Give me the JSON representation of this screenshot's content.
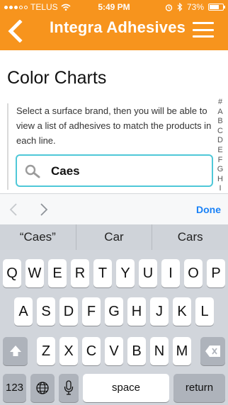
{
  "status_bar": {
    "carrier": "TELUS",
    "time": "5:49 PM",
    "battery": "73%",
    "battery_level": 0.73,
    "icons": [
      "signal-dots-icon",
      "wifi-icon",
      "alarm-icon",
      "bluetooth-icon",
      "battery-icon"
    ]
  },
  "nav": {
    "brand": "Integra Adhesives",
    "back_icon": "chevron-left-icon",
    "menu_icon": "hamburger-menu-icon"
  },
  "main": {
    "title": "Color Charts",
    "instructions": "Select a surface brand, then you will be able to view a list of adhesives to match the products in each line.",
    "search": {
      "value": "Caes",
      "icon": "search-icon"
    },
    "index_letters": [
      "#",
      "A",
      "B",
      "C",
      "D",
      "E",
      "F",
      "G",
      "H",
      "I"
    ]
  },
  "accessory_bar": {
    "prev_icon": "chevron-left-icon",
    "next_icon": "chevron-right-icon",
    "done_label": "Done"
  },
  "keyboard": {
    "suggestions": [
      "“Caes”",
      "Car",
      "Cars"
    ],
    "row1": [
      "Q",
      "W",
      "E",
      "R",
      "T",
      "Y",
      "U",
      "I",
      "O",
      "P"
    ],
    "row2": [
      "A",
      "S",
      "D",
      "F",
      "G",
      "H",
      "J",
      "K",
      "L"
    ],
    "row3": [
      "Z",
      "X",
      "C",
      "V",
      "B",
      "N",
      "M"
    ],
    "numbers_label": "123",
    "space_label": "space",
    "return_label": "return",
    "shift_icon": "shift-icon",
    "delete_icon": "delete-icon",
    "globe_icon": "globe-icon",
    "mic_icon": "microphone-icon"
  },
  "colors": {
    "brand_orange": "#f7941d",
    "search_border": "#4fc8d8",
    "done_blue": "#1a82f7",
    "keyboard_bg": "#d1d5db"
  }
}
